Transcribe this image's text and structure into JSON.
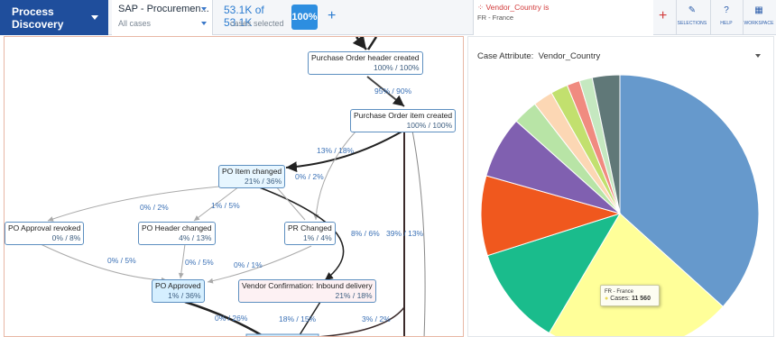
{
  "topbar": {
    "brand": "Process Discovery",
    "dataset_name": "SAP - Procuremen...",
    "dataset_sub": "All cases",
    "count_main": "53.1K of 53.1K",
    "count_sub": "cases selected",
    "percent": "100%",
    "add_symbol": "+",
    "filter_title": "Vendor_Country is",
    "filter_value": "FR - France",
    "filter_add_symbol": "+",
    "toolbar": [
      {
        "label": "SELECTIONS",
        "icon": "pencil-icon",
        "glyph": "✎"
      },
      {
        "label": "HELP",
        "icon": "question-icon",
        "glyph": "?"
      },
      {
        "label": "WORKSPACE",
        "icon": "grid-icon",
        "glyph": "▦"
      }
    ]
  },
  "process_map": {
    "nodes": [
      {
        "id": "poh",
        "name": "Purchase Order header created",
        "stat": "100% / 100%"
      },
      {
        "id": "poi",
        "name": "Purchase Order item created",
        "stat": "100% / 100%"
      },
      {
        "id": "pic",
        "name": "PO Item changed",
        "stat": "21% / 36%"
      },
      {
        "id": "par",
        "name": "PO Approval revoked",
        "stat": "0% / 8%"
      },
      {
        "id": "phc",
        "name": "PO Header changed",
        "stat": "4% / 13%"
      },
      {
        "id": "prc",
        "name": "PR Changed",
        "stat": "1% / 4%"
      },
      {
        "id": "pap",
        "name": "PO Approved",
        "stat": "1% / 36%"
      },
      {
        "id": "vci",
        "name": "Vendor Confirmation: Inbound delivery",
        "stat": "21% / 18%"
      }
    ],
    "edge_labels": [
      "95% / 90%",
      "13% / 18%",
      "0% / 2%",
      "0% / 2%",
      "1% / 5%",
      "8% / 6%",
      "39% / 13%",
      "0% / 5%",
      "0% / 5%",
      "0% / 1%",
      "0% / 26%",
      "18% / 15%",
      "3% / 2%"
    ]
  },
  "case_attribute": {
    "label": "Case Attribute:",
    "value": "Vendor_Country",
    "tooltip": {
      "country": "FR - France",
      "cases_label": "Cases:",
      "cases_value": "11 560"
    }
  },
  "chart_data": {
    "type": "pie",
    "title": "",
    "slices": [
      {
        "value": 36.7,
        "color": "#6699cc"
      },
      {
        "value": 21.8,
        "color": "#ffff99"
      },
      {
        "value": 11.6,
        "color": "#1abc8c"
      },
      {
        "value": 9.3,
        "color": "#f0581e"
      },
      {
        "value": 7.2,
        "color": "#8060b0"
      },
      {
        "value": 2.9,
        "color": "#b8e4a6"
      },
      {
        "value": 2.3,
        "color": "#fcd7b4"
      },
      {
        "value": 2.0,
        "color": "#c2e06e"
      },
      {
        "value": 1.5,
        "color": "#f08b80"
      },
      {
        "value": 1.5,
        "color": "#c5e8c0"
      },
      {
        "value": 3.2,
        "color": "#607878"
      }
    ]
  }
}
